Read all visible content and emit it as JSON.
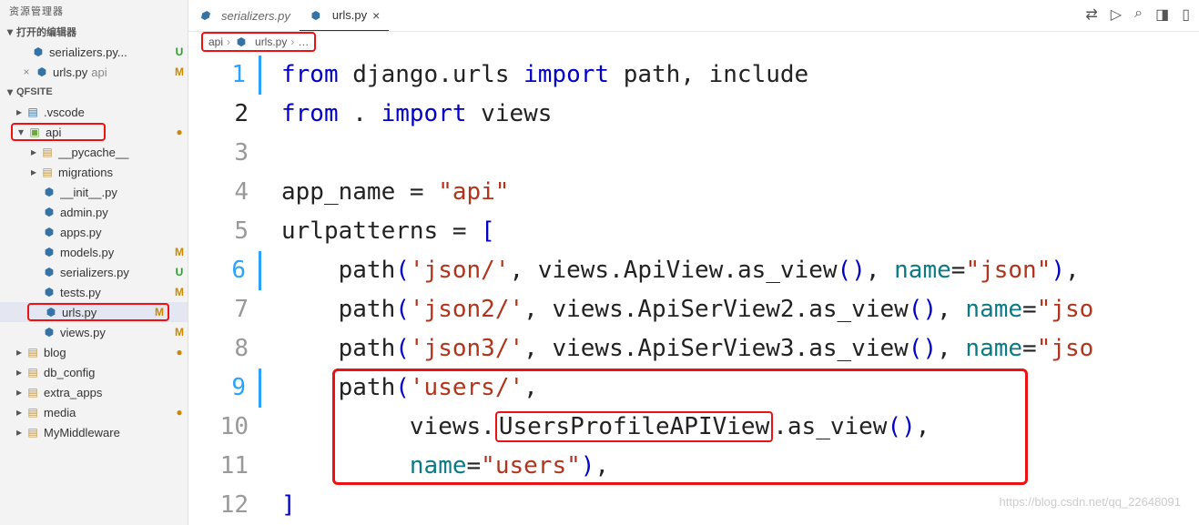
{
  "sidebar": {
    "title": "资源管理器",
    "open_editors_label": "打开的编辑器",
    "open_editors": [
      {
        "name": "serializers.py...",
        "badge": "U"
      },
      {
        "name": "urls.py",
        "dir": "api",
        "badge": "M",
        "close": "×"
      }
    ],
    "workspace_label": "QFSITE",
    "tree": {
      "vscode": ".vscode",
      "api": "api",
      "pycache": "__pycache__",
      "migrations": "migrations",
      "init": "__init__.py",
      "admin": "admin.py",
      "apps": "apps.py",
      "models": "models.py",
      "serializers": "serializers.py",
      "tests": "tests.py",
      "urls": "urls.py",
      "views": "views.py",
      "blog": "blog",
      "db_config": "db_config",
      "extra_apps": "extra_apps",
      "media": "media",
      "mymw": "MyMiddleware"
    },
    "badges": {
      "models": "M",
      "serializers": "U",
      "tests": "M",
      "urls": "M",
      "views": "M"
    }
  },
  "tabs": [
    {
      "name": "serializers.py"
    },
    {
      "name": "urls.py",
      "close": "×",
      "active": true
    }
  ],
  "top_actions": {
    "a": "⇄",
    "b": "▷",
    "c": "⌕",
    "d": "◨",
    "e": "▯"
  },
  "breadcrumb": {
    "p1": "api",
    "p2": "urls.py",
    "p3": "…"
  },
  "code": {
    "kw_from": "from",
    "kw_import": "import",
    "django_mod": "django.urls",
    "imports1": "path, include",
    "dot": ".",
    "imports2": "views",
    "app_name_lhs": "app_name = ",
    "app_name_val": "\"api\"",
    "url_lhs": "urlpatterns = ",
    "open_br": "[",
    "fn_path": "path",
    "op": "(",
    "cp": ")",
    "comma": ", ",
    "json_s": "'json/'",
    "json2_s": "'json2/'",
    "json3_s": "'json3/'",
    "users_s": "'users/'",
    "views_ApiView": "views.ApiView.as_view",
    "views_ApiSer2": "views.ApiSerView2.as_view",
    "views_ApiSer3": "views.ApiSerView3.as_view",
    "views_lbl": "views.",
    "users_class": "UsersProfileAPIView",
    "as_view": ".as_view",
    "name_kw": "name",
    "eq": "=",
    "name_json": "\"json\"",
    "name_jso": "\"jso",
    "name_users": "\"users\"",
    "close_br": "]",
    "truncr": ","
  },
  "watermark": "https://blog.csdn.net/qq_22648091"
}
